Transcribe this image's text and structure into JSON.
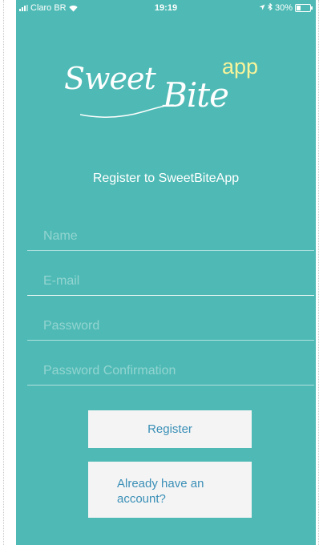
{
  "status_bar": {
    "carrier": "Claro BR",
    "time": "19:19",
    "battery": "30%",
    "battery_level": 0.3
  },
  "logo": {
    "sweet": "Sweet",
    "bite": "Bite",
    "app": "app"
  },
  "title": "Register to SweetBiteApp",
  "form": {
    "name_placeholder": "Name",
    "email_placeholder": "E-mail",
    "password_placeholder": "Password",
    "password_confirmation_placeholder": "Password Confirmation"
  },
  "buttons": {
    "register": "Register",
    "already_have_account": "Already have an account?"
  },
  "colors": {
    "background": "#4fbab5",
    "button_bg": "#f4f4f4",
    "button_text": "#3a8fb7",
    "logo_app": "#f8f49a"
  },
  "icons": [
    "signal-icon",
    "wifi-icon",
    "location-icon",
    "bluetooth-icon",
    "battery-icon"
  ]
}
